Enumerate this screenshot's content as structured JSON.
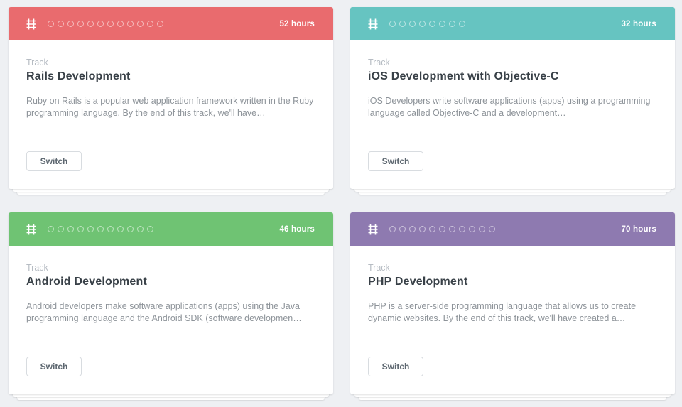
{
  "cards": [
    {
      "color": "#e96b6e",
      "hours": "52 hours",
      "kicker": "Track",
      "title": "Rails Development",
      "description": "Ruby on Rails is a popular web application framework written in the Ruby programming language. By the end of this track, we'll have…",
      "dot_count": 12,
      "button": "Switch"
    },
    {
      "color": "#66c4c1",
      "hours": "32 hours",
      "kicker": "Track",
      "title": "iOS Development with Objective-C",
      "description": "iOS Developers write software applications (apps) using a programming language called Objective-C and a development…",
      "dot_count": 8,
      "button": "Switch"
    },
    {
      "color": "#6fc373",
      "hours": "46 hours",
      "kicker": "Track",
      "title": "Android Development",
      "description": "Android developers make software applications (apps) using the Java programming language and the Android SDK (software developmen…",
      "dot_count": 11,
      "button": "Switch"
    },
    {
      "color": "#8e7ab0",
      "hours": "70 hours",
      "kicker": "Track",
      "title": "PHP Development",
      "description": "PHP is a server-side programming language that allows us to create dynamic websites. By the end of this track, we'll have created a…",
      "dot_count": 11,
      "button": "Switch"
    }
  ]
}
